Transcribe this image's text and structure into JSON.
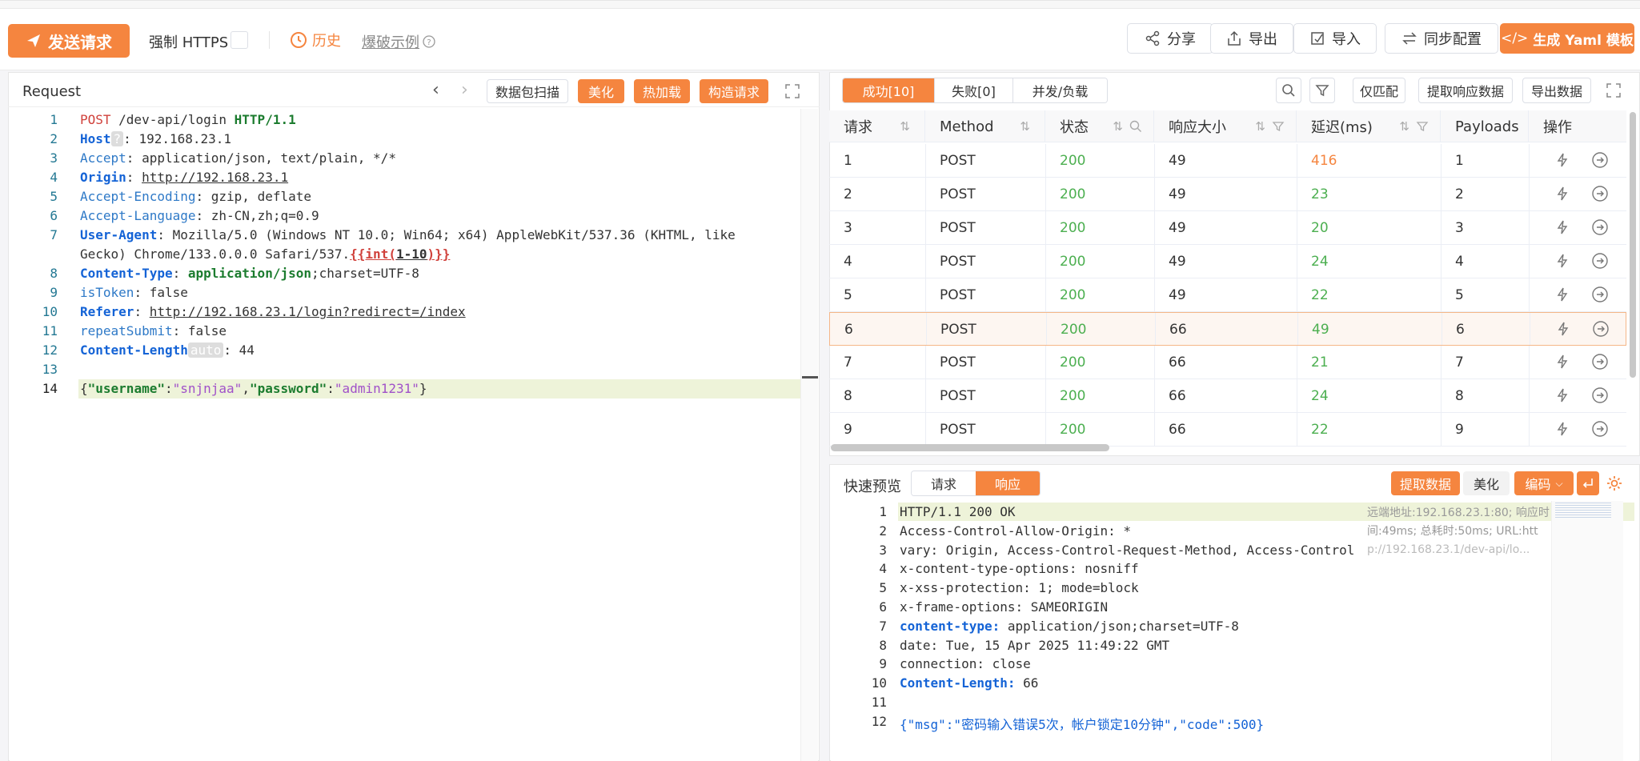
{
  "toolbar": {
    "send_label": "发送请求",
    "force_https_label": "强制 HTTPS",
    "history_label": "历史",
    "example_label": "爆破示例",
    "share_label": "分享",
    "export_label": "导出",
    "import_label": "导入",
    "sync_label": "同步配置",
    "yaml_label": "生成 Yaml 模板"
  },
  "request": {
    "title": "Request",
    "scan_label": "数据包扫描",
    "beautify_label": "美化",
    "hotload_label": "热加载",
    "build_label": "构造请求",
    "lines": [
      {
        "n": "1",
        "method": "POST",
        "path": " /dev-api/login ",
        "proto": "HTTP/1.1"
      },
      {
        "n": "2",
        "key": "Host",
        "ph": "?",
        "val": ": 192.168.23.1"
      },
      {
        "n": "3",
        "key": "Accept",
        "val": ": application/json, text/plain, */*"
      },
      {
        "n": "4",
        "key": "Origin",
        "val": ": ",
        "link": "http://192.168.23.1"
      },
      {
        "n": "5",
        "key": "Accept-Encoding",
        "val": ": gzip, deflate"
      },
      {
        "n": "6",
        "key": "Accept-Language",
        "val": ": zh-CN,zh;q=0.9"
      },
      {
        "n": "7",
        "key": "User-Agent",
        "val": ": Mozilla/5.0 (Windows NT 10.0; Win64; x64) AppleWebKit/537.36 (KHTML, like"
      },
      {
        "n": "",
        "val": "Gecko) Chrome/133.0.0.0 Safari/537.",
        "tpl_open": "{{int(",
        "tpl_mid": "1-10",
        "tpl_close": ")}}"
      },
      {
        "n": "8",
        "key": "Content-Type",
        "val": ": ",
        "val2": "application/json",
        "val3": ";charset=UTF-8"
      },
      {
        "n": "9",
        "key": "isToken",
        "val": ": false"
      },
      {
        "n": "10",
        "key": "Referer",
        "val": ": ",
        "link": "http://192.168.23.1/login?redirect=/index"
      },
      {
        "n": "11",
        "key": "repeatSubmit",
        "val": ": false"
      },
      {
        "n": "12",
        "key": "Content-Length",
        "ph": "auto",
        "val": ": 44"
      },
      {
        "n": "13"
      },
      {
        "n": "14",
        "body_open": "{",
        "k1": "\"username\"",
        "colon1": ":",
        "v1": "\"snjnjaa\"",
        "comma": ",",
        "k2": "\"password\"",
        "colon2": ":",
        "v2": "\"admin1231\"",
        "body_close": "}"
      }
    ]
  },
  "results": {
    "tab_success": "成功[10]",
    "tab_fail": "失败[0]",
    "tab_concurrency": "并发/负载",
    "match_only_label": "仅匹配",
    "extract_resp_label": "提取响应数据",
    "export_data_label": "导出数据",
    "columns": [
      "请求",
      "Method",
      "状态",
      "响应大小",
      "延迟(ms)",
      "Payloads",
      "操作"
    ],
    "rows": [
      {
        "id": "1",
        "method": "POST",
        "status": "200",
        "size": "49",
        "latency": "416",
        "payload": "1"
      },
      {
        "id": "2",
        "method": "POST",
        "status": "200",
        "size": "49",
        "latency": "23",
        "payload": "2"
      },
      {
        "id": "3",
        "method": "POST",
        "status": "200",
        "size": "49",
        "latency": "20",
        "payload": "3"
      },
      {
        "id": "4",
        "method": "POST",
        "status": "200",
        "size": "49",
        "latency": "24",
        "payload": "4"
      },
      {
        "id": "5",
        "method": "POST",
        "status": "200",
        "size": "49",
        "latency": "22",
        "payload": "5"
      },
      {
        "id": "6",
        "method": "POST",
        "status": "200",
        "size": "66",
        "latency": "49",
        "payload": "6"
      },
      {
        "id": "7",
        "method": "POST",
        "status": "200",
        "size": "66",
        "latency": "21",
        "payload": "7"
      },
      {
        "id": "8",
        "method": "POST",
        "status": "200",
        "size": "66",
        "latency": "24",
        "payload": "8"
      },
      {
        "id": "9",
        "method": "POST",
        "status": "200",
        "size": "66",
        "latency": "22",
        "payload": "9"
      }
    ]
  },
  "preview": {
    "title": "快速预览",
    "tab_request": "请求",
    "tab_response": "响应",
    "extract_label": "提取数据",
    "beautify_label": "美化",
    "encode_label": "编码",
    "info_line1": "远端地址:192.168.23.1:80; 响应时",
    "info_line2": "间:49ms; 总耗时:50ms; URL:htt",
    "info_line3": "p://192.168.23.1/dev-api/lo...",
    "lines": [
      {
        "n": "1",
        "text": "HTTP/1.1 200 OK"
      },
      {
        "n": "2",
        "text": "Access-Control-Allow-Origin: *"
      },
      {
        "n": "3",
        "text": "vary: Origin, Access-Control-Request-Method, Access-Control"
      },
      {
        "n": "4",
        "text": "x-content-type-options: nosniff"
      },
      {
        "n": "5",
        "text": "x-xss-protection: 1; mode=block"
      },
      {
        "n": "6",
        "text": "x-frame-options: SAMEORIGIN"
      },
      {
        "n": "7",
        "key": "content-type:",
        "text": " application/json;charset=UTF-8"
      },
      {
        "n": "8",
        "text": "date: Tue, 15 Apr 2025 11:49:22 GMT"
      },
      {
        "n": "9",
        "text": "connection: close"
      },
      {
        "n": "10",
        "key": "Content-Length:",
        "text": " 66"
      },
      {
        "n": "11",
        "text": ""
      },
      {
        "n": "12",
        "text": "{\"msg\":\"密码输入错误5次，帐户锁定10分钟\",\"code\":500}"
      }
    ]
  },
  "colors": {
    "accent": "#f5853f",
    "status_ok": "#4caf50",
    "latency_warn": "#f5853f"
  }
}
